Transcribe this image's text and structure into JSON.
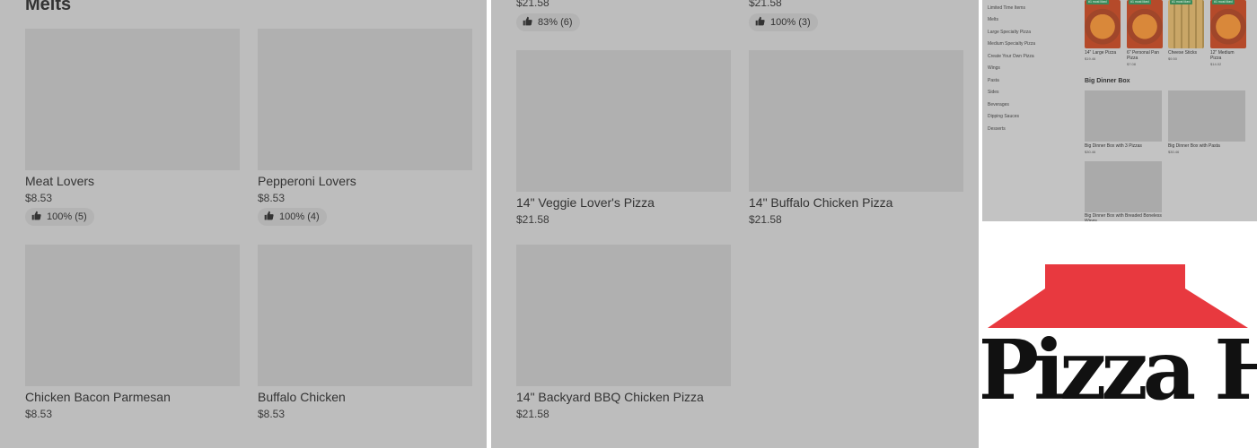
{
  "left": {
    "section_title": "Melts",
    "items": [
      {
        "name": "Meat Lovers",
        "price": "$8.53",
        "rating": "100% (5)"
      },
      {
        "name": "Pepperoni Lovers",
        "price": "$8.53",
        "rating": "100% (4)"
      },
      {
        "name": "Chicken Bacon Parmesan",
        "price": "$8.53"
      },
      {
        "name": "Buffalo Chicken",
        "price": "$8.53"
      }
    ]
  },
  "mid": {
    "top_prices": [
      "$21.58",
      "$21.58"
    ],
    "top_ratings": [
      "83% (6)",
      "100% (3)"
    ],
    "items": [
      {
        "name": "14\" Veggie Lover's Pizza",
        "price": "$21.58"
      },
      {
        "name": "14\" Buffalo Chicken Pizza",
        "price": "$21.58"
      },
      {
        "name": "14\" Backyard BBQ Chicken Pizza",
        "price": "$21.58"
      }
    ]
  },
  "thumb": {
    "categories": [
      "Limited Time Items",
      "Melts",
      "Large Specialty Pizza",
      "Medium Specialty Pizza",
      "Create Your Own Pizza",
      "Wings",
      "Pasta",
      "Sides",
      "Beverages",
      "Dipping Sauces",
      "Desserts"
    ],
    "badge": "#1 most liked",
    "top_items": [
      {
        "name": "14\" Large Pizza",
        "price": "$19.46"
      },
      {
        "name": "6\" Personal Pan Pizza",
        "price": "$7.08"
      },
      {
        "name": "Cheese Sticks",
        "price": "$9.50"
      },
      {
        "name": "12\" Medium Pizza",
        "price": "$14.02"
      }
    ],
    "section_title": "Big Dinner Box",
    "box_items": [
      {
        "name": "Big Dinner Box with 3 Pizzas",
        "price": "$30.46"
      },
      {
        "name": "Big Dinner Box with Pasta",
        "price": "$30.46"
      },
      {
        "name": "Big Dinner Box with Breaded Boneless Wings"
      }
    ]
  },
  "logo": {
    "wordmark": "Pizza Hut",
    "roof_color": "#e8393f",
    "text_color": "#111111"
  },
  "icons": {
    "rating": "thumbs-up-icon"
  }
}
